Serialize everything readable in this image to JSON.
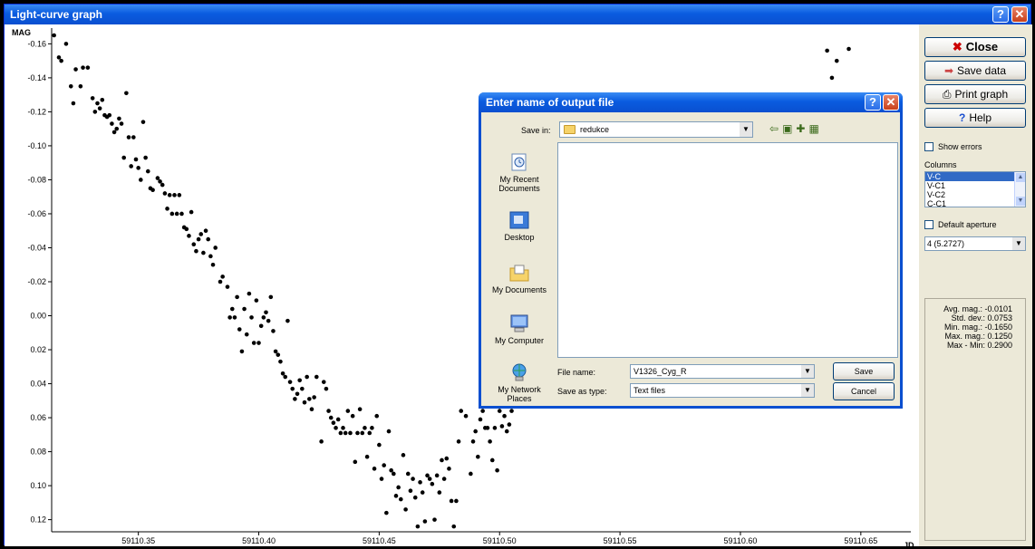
{
  "window": {
    "title": "Light-curve graph",
    "help_glyph": "?",
    "close_glyph": "✕"
  },
  "chart_data": {
    "type": "scatter",
    "title": "",
    "xlabel": "JD",
    "ylabel": "MAG",
    "y_inverted": true,
    "xlim": [
      59110.314,
      59110.667
    ],
    "ylim": [
      -0.165,
      0.125
    ],
    "x_ticks": [
      "59110.35",
      "59110.40",
      "59110.45",
      "59110.50",
      "59110.55",
      "59110.60",
      "59110.65"
    ],
    "y_ticks": [
      "-0.16",
      "-0.14",
      "-0.12",
      "-0.10",
      "-0.08",
      "-0.06",
      "-0.04",
      "-0.02",
      "0.00",
      "0.02",
      "0.04",
      "0.06",
      "0.08",
      "0.10",
      "0.12"
    ],
    "grid": false,
    "marker_color": "#000000",
    "points": [
      [
        59110.315,
        -0.165
      ],
      [
        59110.317,
        -0.152
      ],
      [
        59110.318,
        -0.15
      ],
      [
        59110.32,
        -0.16
      ],
      [
        59110.322,
        -0.135
      ],
      [
        59110.323,
        -0.125
      ],
      [
        59110.324,
        -0.145
      ],
      [
        59110.326,
        -0.135
      ],
      [
        59110.327,
        -0.146
      ],
      [
        59110.329,
        -0.146
      ],
      [
        59110.331,
        -0.128
      ],
      [
        59110.332,
        -0.12
      ],
      [
        59110.333,
        -0.125
      ],
      [
        59110.334,
        -0.122
      ],
      [
        59110.335,
        -0.127
      ],
      [
        59110.336,
        -0.118
      ],
      [
        59110.337,
        -0.117
      ],
      [
        59110.338,
        -0.118
      ],
      [
        59110.339,
        -0.113
      ],
      [
        59110.34,
        -0.108
      ],
      [
        59110.341,
        -0.11
      ],
      [
        59110.342,
        -0.116
      ],
      [
        59110.343,
        -0.113
      ],
      [
        59110.344,
        -0.093
      ],
      [
        59110.345,
        -0.131
      ],
      [
        59110.346,
        -0.105
      ],
      [
        59110.347,
        -0.088
      ],
      [
        59110.348,
        -0.105
      ],
      [
        59110.349,
        -0.092
      ],
      [
        59110.35,
        -0.087
      ],
      [
        59110.351,
        -0.08
      ],
      [
        59110.352,
        -0.114
      ],
      [
        59110.353,
        -0.093
      ],
      [
        59110.354,
        -0.085
      ],
      [
        59110.355,
        -0.075
      ],
      [
        59110.356,
        -0.074
      ],
      [
        59110.358,
        -0.081
      ],
      [
        59110.359,
        -0.079
      ],
      [
        59110.36,
        -0.077
      ],
      [
        59110.361,
        -0.072
      ],
      [
        59110.362,
        -0.063
      ],
      [
        59110.363,
        -0.071
      ],
      [
        59110.364,
        -0.06
      ],
      [
        59110.365,
        -0.071
      ],
      [
        59110.366,
        -0.06
      ],
      [
        59110.367,
        -0.071
      ],
      [
        59110.368,
        -0.06
      ],
      [
        59110.369,
        -0.052
      ],
      [
        59110.37,
        -0.051
      ],
      [
        59110.371,
        -0.047
      ],
      [
        59110.372,
        -0.061
      ],
      [
        59110.373,
        -0.042
      ],
      [
        59110.374,
        -0.038
      ],
      [
        59110.375,
        -0.045
      ],
      [
        59110.376,
        -0.048
      ],
      [
        59110.377,
        -0.037
      ],
      [
        59110.378,
        -0.05
      ],
      [
        59110.379,
        -0.045
      ],
      [
        59110.38,
        -0.035
      ],
      [
        59110.381,
        -0.03
      ],
      [
        59110.382,
        -0.04
      ],
      [
        59110.384,
        -0.02
      ],
      [
        59110.385,
        -0.023
      ],
      [
        59110.387,
        -0.017
      ],
      [
        59110.388,
        0.001
      ],
      [
        59110.389,
        -0.004
      ],
      [
        59110.39,
        0.001
      ],
      [
        59110.391,
        -0.011
      ],
      [
        59110.392,
        0.008
      ],
      [
        59110.393,
        0.021
      ],
      [
        59110.394,
        -0.004
      ],
      [
        59110.395,
        0.011
      ],
      [
        59110.396,
        -0.013
      ],
      [
        59110.397,
        0.001
      ],
      [
        59110.398,
        0.016
      ],
      [
        59110.399,
        -0.009
      ],
      [
        59110.4,
        0.016
      ],
      [
        59110.401,
        0.006
      ],
      [
        59110.402,
        0.001
      ],
      [
        59110.403,
        -0.002
      ],
      [
        59110.404,
        0.003
      ],
      [
        59110.405,
        -0.011
      ],
      [
        59110.406,
        0.009
      ],
      [
        59110.407,
        0.021
      ],
      [
        59110.408,
        0.023
      ],
      [
        59110.409,
        0.027
      ],
      [
        59110.41,
        0.034
      ],
      [
        59110.411,
        0.036
      ],
      [
        59110.412,
        0.003
      ],
      [
        59110.413,
        0.039
      ],
      [
        59110.414,
        0.043
      ],
      [
        59110.415,
        0.049
      ],
      [
        59110.416,
        0.046
      ],
      [
        59110.417,
        0.038
      ],
      [
        59110.418,
        0.043
      ],
      [
        59110.419,
        0.051
      ],
      [
        59110.42,
        0.036
      ],
      [
        59110.421,
        0.049
      ],
      [
        59110.422,
        0.055
      ],
      [
        59110.423,
        0.048
      ],
      [
        59110.424,
        0.036
      ],
      [
        59110.426,
        0.074
      ],
      [
        59110.427,
        0.039
      ],
      [
        59110.428,
        0.043
      ],
      [
        59110.429,
        0.056
      ],
      [
        59110.43,
        0.06
      ],
      [
        59110.431,
        0.063
      ],
      [
        59110.432,
        0.066
      ],
      [
        59110.433,
        0.061
      ],
      [
        59110.434,
        0.069
      ],
      [
        59110.435,
        0.066
      ],
      [
        59110.436,
        0.069
      ],
      [
        59110.437,
        0.056
      ],
      [
        59110.438,
        0.069
      ],
      [
        59110.439,
        0.059
      ],
      [
        59110.44,
        0.086
      ],
      [
        59110.441,
        0.069
      ],
      [
        59110.442,
        0.055
      ],
      [
        59110.443,
        0.069
      ],
      [
        59110.444,
        0.066
      ],
      [
        59110.445,
        0.083
      ],
      [
        59110.446,
        0.069
      ],
      [
        59110.447,
        0.066
      ],
      [
        59110.448,
        0.09
      ],
      [
        59110.449,
        0.059
      ],
      [
        59110.45,
        0.076
      ],
      [
        59110.451,
        0.096
      ],
      [
        59110.452,
        0.088
      ],
      [
        59110.453,
        0.116
      ],
      [
        59110.454,
        0.068
      ],
      [
        59110.455,
        0.091
      ],
      [
        59110.456,
        0.093
      ],
      [
        59110.457,
        0.106
      ],
      [
        59110.458,
        0.101
      ],
      [
        59110.459,
        0.108
      ],
      [
        59110.46,
        0.082
      ],
      [
        59110.461,
        0.114
      ],
      [
        59110.462,
        0.093
      ],
      [
        59110.463,
        0.103
      ],
      [
        59110.464,
        0.096
      ],
      [
        59110.465,
        0.107
      ],
      [
        59110.466,
        0.124
      ],
      [
        59110.467,
        0.098
      ],
      [
        59110.468,
        0.104
      ],
      [
        59110.469,
        0.121
      ],
      [
        59110.47,
        0.094
      ],
      [
        59110.471,
        0.096
      ],
      [
        59110.472,
        0.099
      ],
      [
        59110.473,
        0.12
      ],
      [
        59110.474,
        0.094
      ],
      [
        59110.475,
        0.104
      ],
      [
        59110.476,
        0.085
      ],
      [
        59110.477,
        0.096
      ],
      [
        59110.478,
        0.084
      ],
      [
        59110.479,
        0.09
      ],
      [
        59110.48,
        0.109
      ],
      [
        59110.481,
        0.124
      ],
      [
        59110.482,
        0.109
      ],
      [
        59110.483,
        0.074
      ],
      [
        59110.484,
        0.056
      ],
      [
        59110.486,
        0.059
      ],
      [
        59110.488,
        0.093
      ],
      [
        59110.489,
        0.074
      ],
      [
        59110.49,
        0.068
      ],
      [
        59110.491,
        0.083
      ],
      [
        59110.492,
        0.061
      ],
      [
        59110.493,
        0.056
      ],
      [
        59110.494,
        0.066
      ],
      [
        59110.495,
        0.066
      ],
      [
        59110.496,
        0.074
      ],
      [
        59110.497,
        0.085
      ],
      [
        59110.498,
        0.066
      ],
      [
        59110.499,
        0.091
      ],
      [
        59110.5,
        0.056
      ],
      [
        59110.501,
        0.065
      ],
      [
        59110.502,
        0.059
      ],
      [
        59110.503,
        0.068
      ],
      [
        59110.504,
        0.064
      ],
      [
        59110.505,
        0.056
      ]
    ],
    "points_right": [
      [
        59110.636,
        -0.156
      ],
      [
        59110.64,
        -0.15
      ],
      [
        59110.645,
        -0.157
      ],
      [
        59110.638,
        -0.14
      ]
    ]
  },
  "sidebar": {
    "close_label": "Close",
    "save_label": "Save data",
    "print_label": "Print graph",
    "help_label": "Help",
    "show_errors_label": "Show errors",
    "columns_label": "Columns",
    "columns_items": [
      "V-C",
      "V-C1",
      "V-C2",
      "C-C1"
    ],
    "default_aperture_label": "Default aperture",
    "aperture_value": "4 (5.2727)",
    "stats": [
      "Avg. mag.: -0.0101",
      "Std. dev.: 0.0753",
      "Min. mag.: -0.1650",
      "Max. mag.: 0.1250",
      "Max - Min: 0.2900"
    ]
  },
  "dialog": {
    "title": "Enter name of output file",
    "save_in_label": "Save in:",
    "save_in_value": "redukce",
    "places": [
      "My Recent Documents",
      "Desktop",
      "My Documents",
      "My Computer",
      "My Network Places"
    ],
    "file_name_label": "File name:",
    "file_name_value": "V1326_Cyg_R",
    "save_as_type_label": "Save as type:",
    "save_as_type_value": "Text files",
    "save_button": "Save",
    "cancel_button": "Cancel"
  }
}
